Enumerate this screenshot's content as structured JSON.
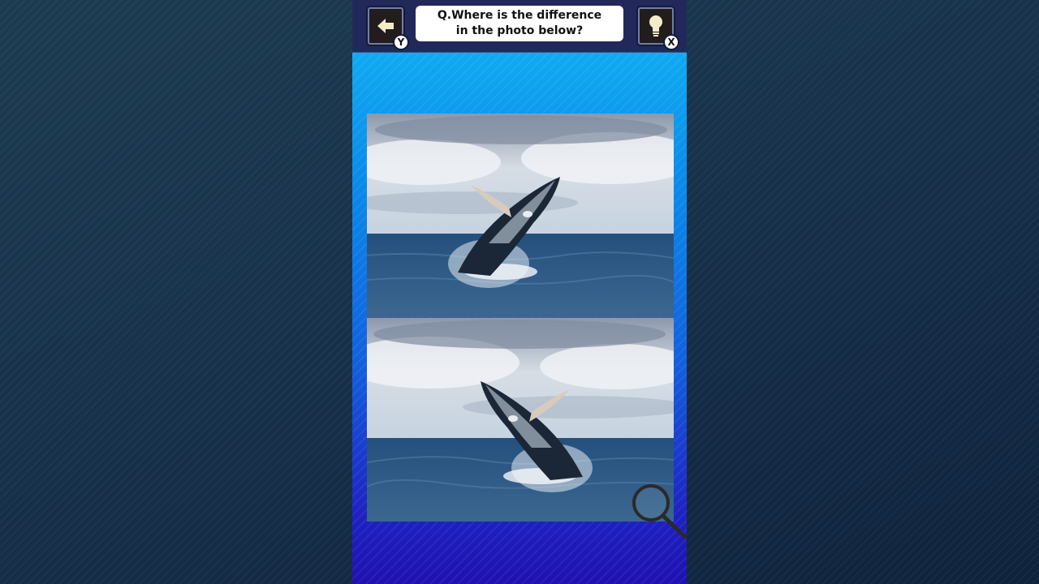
{
  "question": "Q.Where is the difference\nin the photo below?",
  "controls": {
    "back_key": "Y",
    "hint_key": "X"
  },
  "icons": {
    "back": "arrow-left-icon",
    "hint": "lightbulb-icon",
    "cursor": "magnifier-icon"
  },
  "photos": [
    {
      "subject": "humpback-whale-breaching",
      "orientation": "original"
    },
    {
      "subject": "humpback-whale-breaching",
      "orientation": "mirrored"
    }
  ],
  "colors": {
    "topbar": "#23285a",
    "panel_top": "#12b7f4",
    "panel_bottom": "#1f10b0"
  }
}
